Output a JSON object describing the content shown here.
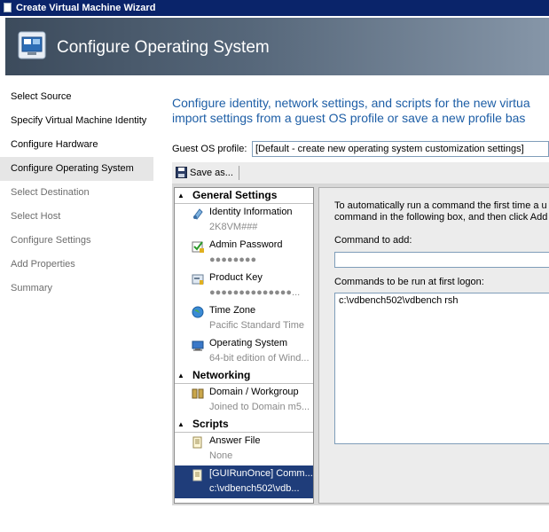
{
  "window": {
    "title": "Create Virtual Machine Wizard"
  },
  "banner": {
    "title": "Configure Operating System"
  },
  "sidebar": {
    "items": [
      {
        "label": "Select Source"
      },
      {
        "label": "Specify Virtual Machine Identity"
      },
      {
        "label": "Configure Hardware"
      },
      {
        "label": "Configure Operating System",
        "current": true
      },
      {
        "label": "Select Destination"
      },
      {
        "label": "Select Host"
      },
      {
        "label": "Configure Settings"
      },
      {
        "label": "Add Properties"
      },
      {
        "label": "Summary"
      }
    ]
  },
  "intro": {
    "line1": "Configure identity, network settings, and scripts for the new virtua",
    "line2": "import settings from a guest OS profile or save a new profile bas"
  },
  "guest_os": {
    "label": "Guest OS profile:",
    "selected": "[Default - create new operating system customization settings]"
  },
  "toolbar": {
    "save_label": "Save as..."
  },
  "tree": {
    "sections": [
      {
        "title": "General Settings",
        "items": [
          {
            "icon": "identity-icon",
            "label": "Identity Information",
            "value": "2K8VM###"
          },
          {
            "icon": "admin-password-icon",
            "label": "Admin Password",
            "value": "●●●●●●●●"
          },
          {
            "icon": "product-key-icon",
            "label": "Product Key",
            "value": "●●●●●●●●●●●●●●..."
          },
          {
            "icon": "time-zone-icon",
            "label": "Time Zone",
            "value": "Pacific Standard Time"
          },
          {
            "icon": "operating-system-icon",
            "label": "Operating System",
            "value": "64-bit edition of Wind..."
          }
        ]
      },
      {
        "title": "Networking",
        "items": [
          {
            "icon": "domain-workgroup-icon",
            "label": "Domain / Workgroup",
            "value": "Joined to Domain m5..."
          }
        ]
      },
      {
        "title": "Scripts",
        "items": [
          {
            "icon": "answer-file-icon",
            "label": "Answer File",
            "value": "None"
          },
          {
            "icon": "script-icon",
            "label": "[GUIRunOnce] Comm...",
            "value": "c:\\vdbench502\\vdb...",
            "selected": true
          }
        ]
      }
    ]
  },
  "detail": {
    "instruction_line1": "To automatically run a command the first time a use",
    "instruction_line2": "command in the following box, and then click Add.",
    "command_label": "Command to add:",
    "command_value": "",
    "run_label": "Commands to be run at first logon:",
    "commands": [
      "c:\\vdbench502\\vdbench rsh"
    ]
  },
  "colors": {
    "title_bar": "#0a246a",
    "intro_text": "#1d5ea6",
    "tree_selection": "#1f3d7a"
  }
}
